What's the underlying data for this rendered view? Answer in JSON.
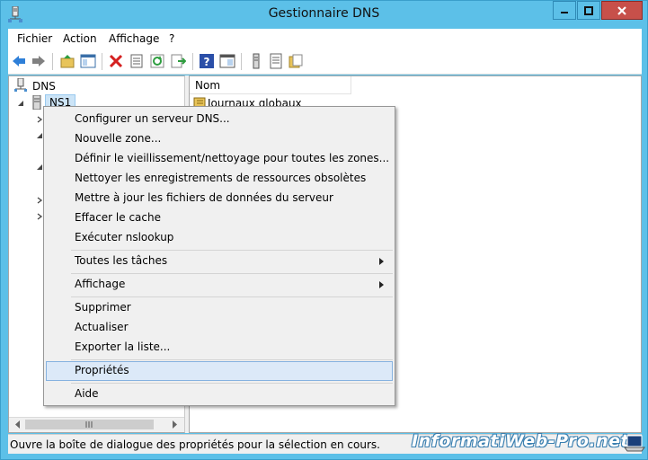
{
  "window": {
    "title": "Gestionnaire DNS"
  },
  "menubar": [
    "Fichier",
    "Action",
    "Affichage",
    "?"
  ],
  "tree": {
    "root": "DNS",
    "selected": "NS1"
  },
  "list": {
    "column_name": "Nom",
    "first_item": "Journaux globaux"
  },
  "context_menu": {
    "configure": "Configurer un serveur DNS...",
    "new_zone": "Nouvelle zone...",
    "aging": "Définir le vieillissement/nettoyage pour toutes les zones...",
    "scavenge": "Nettoyer les enregistrements de ressources obsolètes",
    "update": "Mettre à jour les fichiers de données du serveur",
    "clear_cache": "Effacer le cache",
    "nslookup": "Exécuter nslookup",
    "all_tasks": "Toutes les tâches",
    "view": "Affichage",
    "delete": "Supprimer",
    "refresh": "Actualiser",
    "export": "Exporter la liste...",
    "properties": "Propriétés",
    "help": "Aide"
  },
  "statusbar": {
    "text": "Ouvre la boîte de dialogue des propriétés pour la sélection en cours."
  },
  "watermark": "InformatiWeb-Pro.net",
  "colors": {
    "titlebar": "#5cc0e8",
    "close_button": "#c7504a",
    "menu_highlight": "#dce9f8"
  }
}
